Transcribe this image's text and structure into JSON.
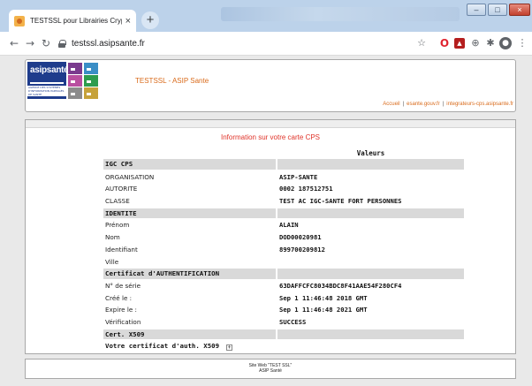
{
  "browser": {
    "tab_title": "TESTSSL pour Librairies Crypto C",
    "tab_close": "×",
    "new_tab": "+",
    "url": "testssl.asipsante.fr",
    "window_controls": {
      "minimize": "–",
      "maximize": "□",
      "close": "×"
    },
    "nav_icons": [
      "back-icon",
      "forward-icon",
      "reload-icon"
    ],
    "extension_icons": [
      "star-icon",
      "opera-icon",
      "pdf-icon",
      "zoom-icon",
      "extensions-icon",
      "profile-icon",
      "menu-icon"
    ]
  },
  "header": {
    "logo_text": "asipsanté",
    "logo_subtitle": "AGENCE DES SYSTÈMES D'INFORMATION PARTAGÉS DE SANTÉ",
    "site_title": "TESTSSL - ASIP Sante",
    "links": [
      "Accueil",
      "esante.gouv.fr",
      "integrateurs-cps.asipsante.fr"
    ],
    "link_separator": "|"
  },
  "main": {
    "title": "Information sur votre carte CPS",
    "column_header": "Valeurs",
    "rows": [
      {
        "type": "section",
        "label": "IGC CPS",
        "value": ""
      },
      {
        "type": "field",
        "label": "ORGANISATION",
        "value": "ASIP-SANTE"
      },
      {
        "type": "field",
        "label": "AUTORITE",
        "value": "0002 187512751"
      },
      {
        "type": "field",
        "label": "CLASSE",
        "value": "TEST AC IGC-SANTE FORT PERSONNES"
      },
      {
        "type": "section",
        "label": "IDENTITE",
        "value": ""
      },
      {
        "type": "field",
        "label": "Prénom",
        "value": "ALAIN"
      },
      {
        "type": "field",
        "label": "Nom",
        "value": "DOD00020981"
      },
      {
        "type": "field",
        "label": "Identifiant",
        "value": "899700209812"
      },
      {
        "type": "field",
        "label": "Ville",
        "value": ""
      },
      {
        "type": "section",
        "label": "Certificat d'AUTHENTIFICATION",
        "value": ""
      },
      {
        "type": "field",
        "label": "N° de série",
        "value": "63DAFFCFC8034BDC8F41AAE54F280CF4"
      },
      {
        "type": "field",
        "label": "Créé le :",
        "value": "Sep 1 11:46:48 2018 GMT"
      },
      {
        "type": "field",
        "label": "Expire le :",
        "value": "Sep 1 11:46:48 2021 GMT"
      },
      {
        "type": "field",
        "label": "Vérification",
        "value": "SUCCESS"
      },
      {
        "type": "section",
        "label": "Cert. X509",
        "value": ""
      },
      {
        "type": "cert",
        "label": "Votre certificat d'auth. X509",
        "value": ""
      }
    ],
    "expand_symbol": "⊞"
  },
  "footer": {
    "line1": "Site Web \"TEST SSL\"",
    "line2": "ASIP Santé"
  }
}
